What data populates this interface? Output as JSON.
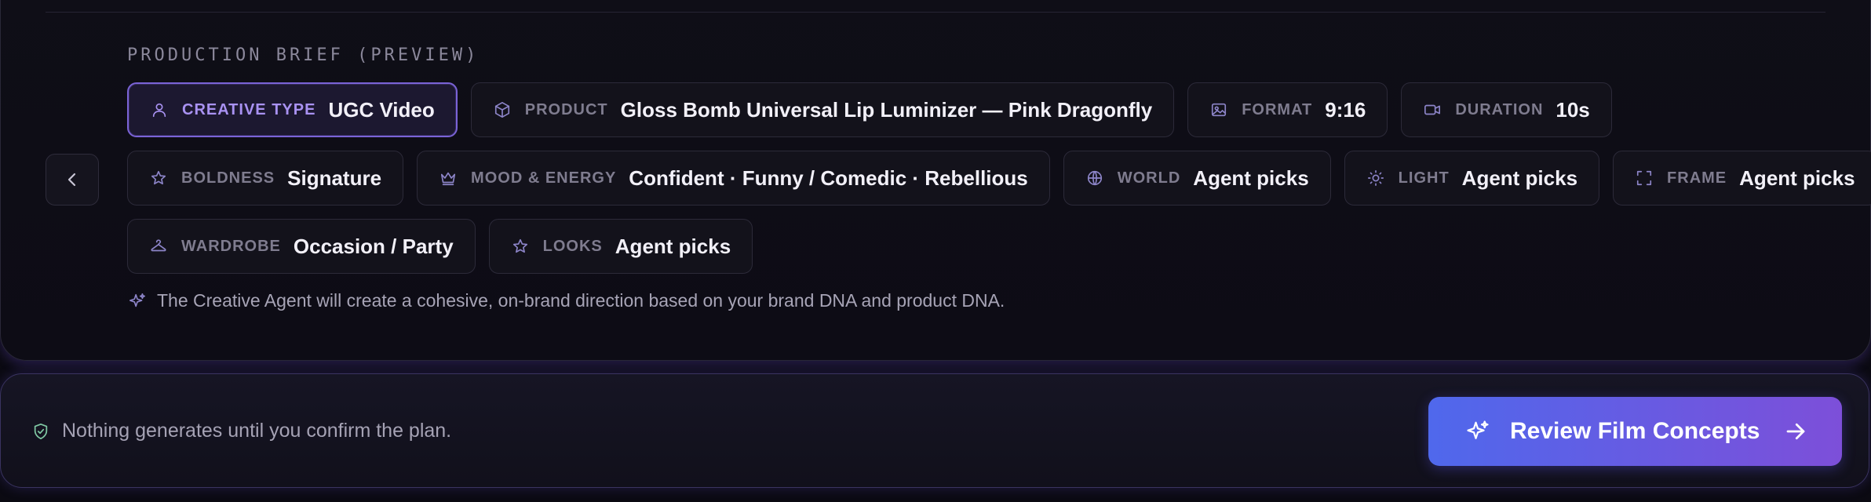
{
  "brief": {
    "title": "PRODUCTION BRIEF (PREVIEW)",
    "rows": [
      [
        {
          "icon": "person-icon",
          "label": "CREATIVE TYPE",
          "value": "UGC Video",
          "active": true
        },
        {
          "icon": "box-icon",
          "label": "PRODUCT",
          "value": "Gloss Bomb Universal Lip Luminizer — Pink Dragonfly"
        },
        {
          "icon": "image-icon",
          "label": "FORMAT",
          "value": "9:16"
        },
        {
          "icon": "video-icon",
          "label": "DURATION",
          "value": "10s"
        }
      ],
      [
        {
          "icon": "star-icon",
          "label": "BOLDNESS",
          "value": "Signature"
        },
        {
          "icon": "crown-icon",
          "label": "MOOD & ENERGY",
          "value": "Confident · Funny / Comedic · Rebellious"
        },
        {
          "icon": "globe-icon",
          "label": "WORLD",
          "value": "Agent picks"
        },
        {
          "icon": "sun-icon",
          "label": "LIGHT",
          "value": "Agent picks"
        },
        {
          "icon": "frame-icon",
          "label": "FRAME",
          "value": "Agent picks"
        }
      ],
      [
        {
          "icon": "hanger-icon",
          "label": "WARDROBE",
          "value": "Occasion / Party"
        },
        {
          "icon": "star-icon",
          "label": "LOOKS",
          "value": "Agent picks"
        }
      ]
    ],
    "note": "The Creative Agent will create a cohesive, on-brand direction based on your brand DNA and product DNA."
  },
  "confirm": {
    "note": "Nothing generates until you confirm the plan.",
    "button_label": "Review Film Concepts"
  },
  "colors": {
    "accent": "#7a63d6",
    "icon": "#8d85c9",
    "shield": "#7fc7a3",
    "button_start": "#4f68ec",
    "button_end": "#7d4fd9"
  }
}
